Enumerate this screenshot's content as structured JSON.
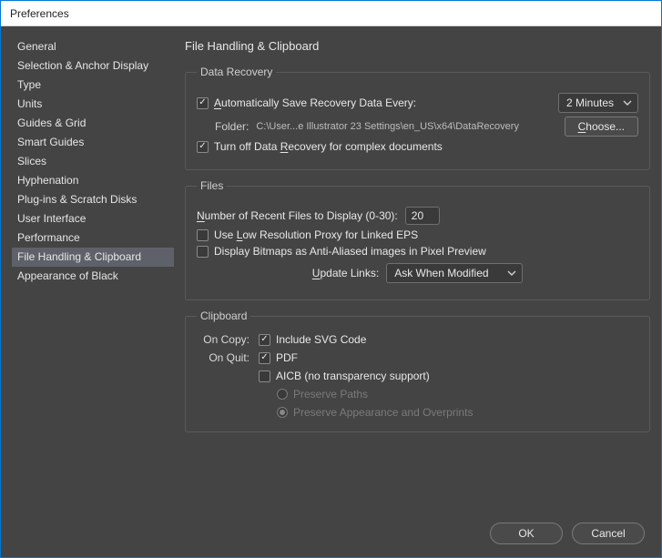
{
  "window": {
    "title": "Preferences"
  },
  "sidebar": {
    "items": [
      {
        "label": "General"
      },
      {
        "label": "Selection & Anchor Display"
      },
      {
        "label": "Type"
      },
      {
        "label": "Units"
      },
      {
        "label": "Guides & Grid"
      },
      {
        "label": "Smart Guides"
      },
      {
        "label": "Slices"
      },
      {
        "label": "Hyphenation"
      },
      {
        "label": "Plug-ins & Scratch Disks"
      },
      {
        "label": "User Interface"
      },
      {
        "label": "Performance"
      },
      {
        "label": "File Handling & Clipboard",
        "selected": true
      },
      {
        "label": "Appearance of Black"
      }
    ]
  },
  "panel": {
    "title": "File Handling & Clipboard",
    "dataRecovery": {
      "legend": "Data Recovery",
      "autoSave": {
        "checked": true,
        "prefix": "A",
        "rest": "utomatically Save Recovery Data Every:"
      },
      "interval": {
        "value": "2 Minutes"
      },
      "folderLabel": "Folder:",
      "folderPath": "C:\\User...e Illustrator 23 Settings\\en_US\\x64\\DataRecovery",
      "chooseLabel": "Choose...",
      "turnOff": {
        "checked": true,
        "pre": "Turn off Data ",
        "u": "R",
        "post": "ecovery for complex documents"
      }
    },
    "files": {
      "legend": "Files",
      "recent": {
        "labelPre": "N",
        "labelU": "",
        "pre": "",
        "u": "N",
        "rest": "umber of Recent Files to Display (0-30):",
        "value": "20"
      },
      "lowRes": {
        "checked": false,
        "pre": "Use ",
        "u": "L",
        "post": "ow Resolution Proxy for Linked EPS"
      },
      "bitmaps": {
        "checked": false,
        "label": "Display Bitmaps as Anti-Aliased images in Pixel Preview"
      },
      "updateLinks": {
        "labelPre": "",
        "u": "U",
        "labelPost": "pdate Links:",
        "value": "Ask When Modified"
      }
    },
    "clipboard": {
      "legend": "Clipboard",
      "onCopyLabel": "On Copy:",
      "onQuitLabel": "On Quit:",
      "svg": {
        "checked": true,
        "label": "Include SVG Code"
      },
      "pdf": {
        "checked": true,
        "label": "PDF"
      },
      "aicb": {
        "checked": false,
        "label": "AICB (no transparency support)"
      },
      "preservePaths": {
        "selected": false,
        "label": "Preserve Paths"
      },
      "preserveAppearance": {
        "selected": true,
        "label": "Preserve Appearance and Overprints"
      }
    }
  },
  "footer": {
    "ok": "OK",
    "cancel": "Cancel"
  }
}
